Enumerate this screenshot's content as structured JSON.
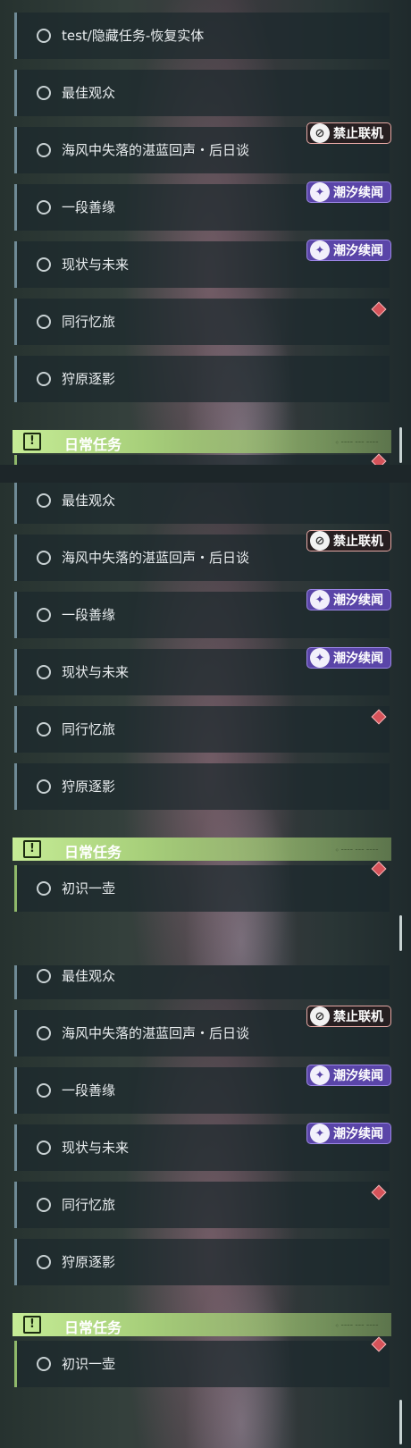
{
  "colors": {
    "daily_header": "#b8df86",
    "tide_tag": "#5a45a8",
    "offline_tag_border": "#e7a9a5",
    "marker": "#d6535a"
  },
  "icons": {
    "offline": "no-multiplayer-icon",
    "tide": "tide-story-icon",
    "daily": "exclamation-icon"
  },
  "quests": {
    "restore": "test/隐藏任务-恢复实体",
    "best_audience": "最佳观众",
    "sea_breeze": "海风中失落的湛蓝回声・后日谈",
    "good_bond": "一段善缘",
    "status_quo": "现状与未来",
    "travel_memory": "同行忆旅",
    "hunt_shadow": "狩原逐影",
    "first_pot": "初识一壶"
  },
  "tags": {
    "offline": "禁止联机",
    "tide": "潮汐续闻"
  },
  "sections": {
    "daily": "日常任务",
    "daily_deco": "◇ ━━━━ ━━━ ━━━━"
  }
}
